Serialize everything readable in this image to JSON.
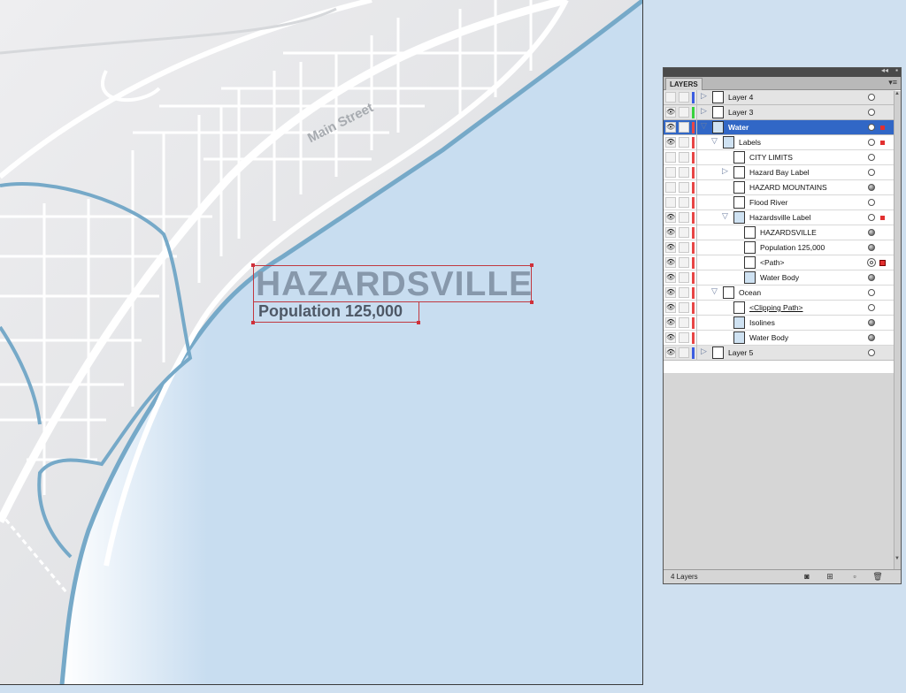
{
  "map": {
    "street_label": "Main Street",
    "city_name": "HAZARDSVILLE",
    "population_label": "Population 125,000",
    "colors": {
      "land": "#e9eaec",
      "water": "#c8ddf0",
      "river": "#76a9c8",
      "road": "#ffffff",
      "title": "#8798ab",
      "subtitle": "#4e5866",
      "selection": "#c13840"
    }
  },
  "layers_panel": {
    "tab_title": "LAYERS",
    "collapse_icon": "double-chevron-icon",
    "menu_icon": "panel-menu-icon",
    "footer_count": "4 Layers",
    "rows": [
      {
        "name": "Layer 4",
        "level": 0,
        "visible": false,
        "color": "#3c5de0",
        "expand": "collapsed",
        "thumb": "white",
        "target": "empty",
        "selected": false
      },
      {
        "name": "Layer 3",
        "level": 0,
        "visible": true,
        "color": "#38d23e",
        "expand": "collapsed",
        "thumb": "white",
        "target": "empty",
        "selected": false
      },
      {
        "name": "Water",
        "level": 0,
        "visible": true,
        "color": "#e84646",
        "expand": "expanded",
        "thumb": "blue",
        "target": "empty",
        "selected": true,
        "mark": "small"
      },
      {
        "name": "Labels",
        "level": 1,
        "visible": true,
        "color": "#e84646",
        "expand": "expanded",
        "thumb": "blue",
        "target": "empty",
        "selected": false,
        "mark": "small"
      },
      {
        "name": "CITY LIMITS",
        "level": 2,
        "visible": false,
        "color": "#e84646",
        "expand": "none",
        "thumb": "white",
        "target": "empty",
        "selected": false
      },
      {
        "name": "Hazard Bay Label",
        "level": 2,
        "visible": false,
        "color": "#e84646",
        "expand": "collapsed",
        "thumb": "white",
        "target": "empty",
        "selected": false
      },
      {
        "name": "HAZARD    MOUNTAINS",
        "level": 2,
        "visible": false,
        "color": "#e84646",
        "expand": "none",
        "thumb": "white",
        "target": "filled",
        "selected": false
      },
      {
        "name": "Flood River",
        "level": 2,
        "visible": false,
        "color": "#e84646",
        "expand": "none",
        "thumb": "white",
        "target": "empty",
        "selected": false
      },
      {
        "name": "Hazardsville Label",
        "level": 2,
        "visible": true,
        "color": "#e84646",
        "expand": "expanded",
        "thumb": "blue",
        "target": "empty",
        "selected": false,
        "mark": "small"
      },
      {
        "name": "HAZARDSVILLE",
        "level": 3,
        "visible": true,
        "color": "#e84646",
        "expand": "none",
        "thumb": "white",
        "target": "filled",
        "selected": false
      },
      {
        "name": "Population 125,000",
        "level": 3,
        "visible": true,
        "color": "#e84646",
        "expand": "none",
        "thumb": "white",
        "target": "filled",
        "selected": false
      },
      {
        "name": "<Path>",
        "level": 3,
        "visible": true,
        "color": "#e84646",
        "expand": "none",
        "thumb": "white",
        "target": "double",
        "selected": false,
        "mark": "big"
      },
      {
        "name": "Water Body",
        "level": 3,
        "visible": true,
        "color": "#e84646",
        "expand": "none",
        "thumb": "blue",
        "target": "filled",
        "selected": false
      },
      {
        "name": "Ocean",
        "level": 1,
        "visible": true,
        "color": "#e84646",
        "expand": "expanded",
        "thumb": "white",
        "target": "empty",
        "selected": false
      },
      {
        "name": "<Clipping Path>",
        "level": 2,
        "visible": true,
        "color": "#e84646",
        "expand": "none",
        "thumb": "white",
        "target": "empty",
        "selected": false,
        "underline": true
      },
      {
        "name": "Isolines",
        "level": 2,
        "visible": true,
        "color": "#e84646",
        "expand": "none",
        "thumb": "blue",
        "target": "filled",
        "selected": false
      },
      {
        "name": "Water Body",
        "level": 2,
        "visible": true,
        "color": "#e84646",
        "expand": "none",
        "thumb": "blue",
        "target": "filled",
        "selected": false
      },
      {
        "name": "Layer 5",
        "level": 0,
        "visible": true,
        "color": "#3c5de0",
        "expand": "collapsed",
        "thumb": "white",
        "target": "empty",
        "selected": false
      }
    ],
    "footer_buttons": [
      "make-clipping-mask-icon",
      "create-sublayer-icon",
      "create-layer-icon",
      "trash-icon"
    ]
  }
}
